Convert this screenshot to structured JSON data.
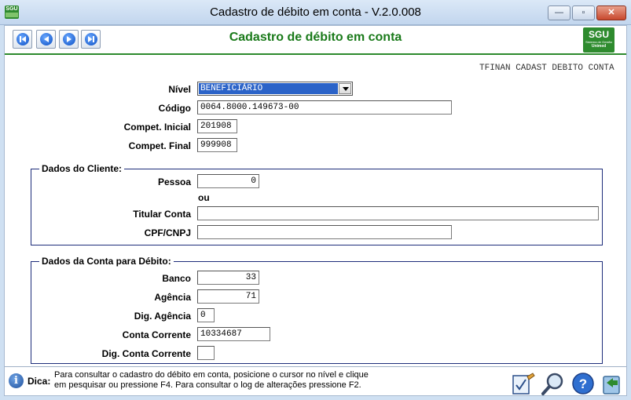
{
  "window": {
    "app_icon_text": "SGU",
    "title": "Cadastro de débito em conta - V.2.0.008",
    "minimize": "—",
    "maximize": "▫",
    "close": "✕"
  },
  "header": {
    "title": "Cadastro de débito em conta",
    "logo_text": "SGU",
    "logo_subtitle": "Sistema de Gestão",
    "logo_brand": "Unimed"
  },
  "form_code": "TFINAN CADAST DEBITO CONTA",
  "form": {
    "nivel_label": "Nível",
    "nivel_value": "BENEFICIÁRIO",
    "codigo_label": "Código",
    "codigo_value": "0064.8000.149673-00",
    "compet_inicial_label": "Compet. Inicial",
    "compet_inicial_value": "201908",
    "compet_final_label": "Compet. Final",
    "compet_final_value": "999908"
  },
  "cliente": {
    "group_title": "Dados do Cliente:",
    "pessoa_label": "Pessoa",
    "pessoa_value": "0",
    "ou_label": "ou",
    "titular_label": "Titular Conta",
    "titular_value": "",
    "cpf_label": "CPF/CNPJ",
    "cpf_value": ""
  },
  "conta": {
    "group_title": "Dados da Conta para Débito:",
    "banco_label": "Banco",
    "banco_value": "33",
    "agencia_label": "Agência",
    "agencia_value": "71",
    "dig_agencia_label": "Dig. Agência",
    "dig_agencia_value": "0",
    "conta_label": "Conta Corrente",
    "conta_value": "10334687",
    "dig_conta_label": "Dig. Conta Corrente",
    "dig_conta_value": ""
  },
  "tip": {
    "label": "Dica:",
    "text_line1": "Para consultar o cadastro do débito em conta, posicione o cursor no nível e clique",
    "text_line2": "em pesquisar ou pressione F4. Para consultar o log de alterações pressione F2."
  },
  "colors": {
    "accent_green": "#1a7a1a",
    "group_border": "#1d2d7a",
    "nav_blue": "#0b4fc4"
  },
  "icons": [
    "first-record-icon",
    "previous-record-icon",
    "next-record-icon",
    "last-record-icon",
    "info-icon",
    "edit-icon",
    "search-icon",
    "help-icon",
    "exit-icon"
  ]
}
